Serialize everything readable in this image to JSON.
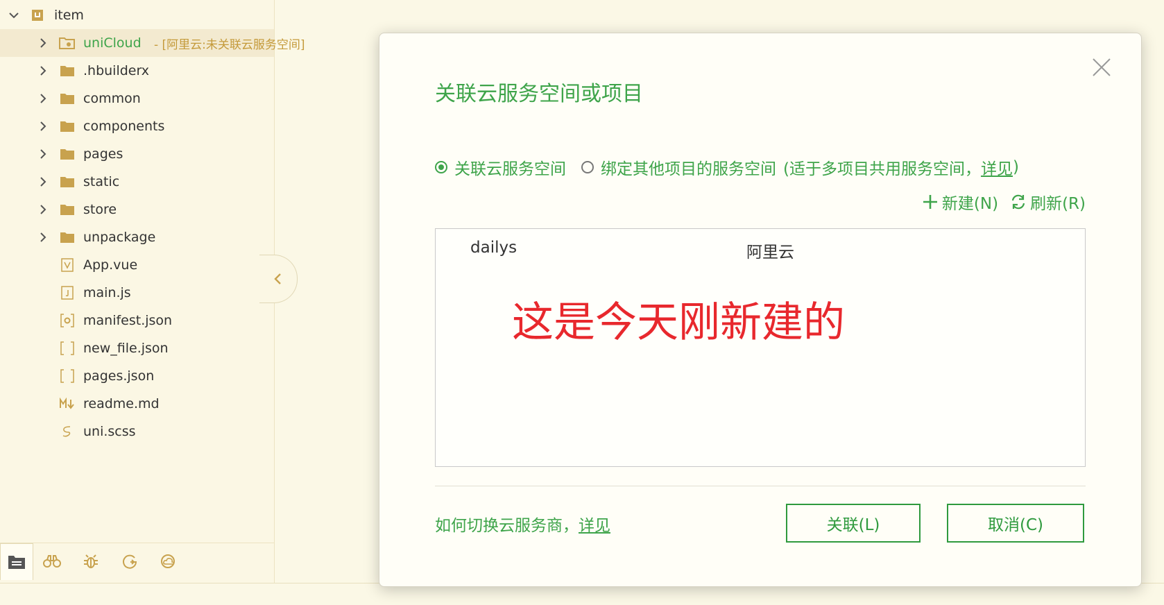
{
  "tree": {
    "root": {
      "label": "item"
    },
    "project": {
      "label": "uniCloud",
      "sublabel": "- [阿里云:未关联云服务空间]"
    },
    "folders": [
      {
        "label": ".hbuilderx"
      },
      {
        "label": "common"
      },
      {
        "label": "components"
      },
      {
        "label": "pages"
      },
      {
        "label": "static"
      },
      {
        "label": "store"
      },
      {
        "label": "unpackage"
      }
    ],
    "files": [
      {
        "label": "App.vue",
        "icon": "vue-file-icon"
      },
      {
        "label": "main.js",
        "icon": "js-file-icon"
      },
      {
        "label": "manifest.json",
        "icon": "manifest-file-icon"
      },
      {
        "label": "new_file.json",
        "icon": "json-file-icon"
      },
      {
        "label": "pages.json",
        "icon": "json-file-icon"
      },
      {
        "label": "readme.md",
        "icon": "markdown-file-icon"
      },
      {
        "label": "uni.scss",
        "icon": "scss-file-icon"
      }
    ]
  },
  "bottom_toolbar": [
    "project-manager-icon",
    "binoculars-icon",
    "bug-icon",
    "run-icon",
    "cloud-icon"
  ],
  "dialog": {
    "title": "关联云服务空间或项目",
    "radio_options": [
      {
        "label": "关联云服务空间",
        "checked": true
      },
      {
        "label": "绑定其他项目的服务空间",
        "checked": false
      }
    ],
    "radio_hint": "(适于多项目共用服务空间，",
    "radio_hint_link": "详见",
    "radio_hint_end": ")",
    "actions": {
      "new_label": "新建(N)",
      "refresh_label": "刷新(R)"
    },
    "list": {
      "rows": [
        {
          "name": "dailys",
          "provider": "阿里云"
        }
      ]
    },
    "annotation": "这是今天刚新建的",
    "footer_help": "如何切换云服务商，",
    "footer_help_link": "详见",
    "buttons": {
      "confirm_label": "关联(L)",
      "cancel_label": "取消(C)"
    }
  },
  "colors": {
    "accent": "#3ea44a",
    "annotation": "#e8282d",
    "folder": "#c8a24e",
    "background": "#fbf8e6"
  }
}
